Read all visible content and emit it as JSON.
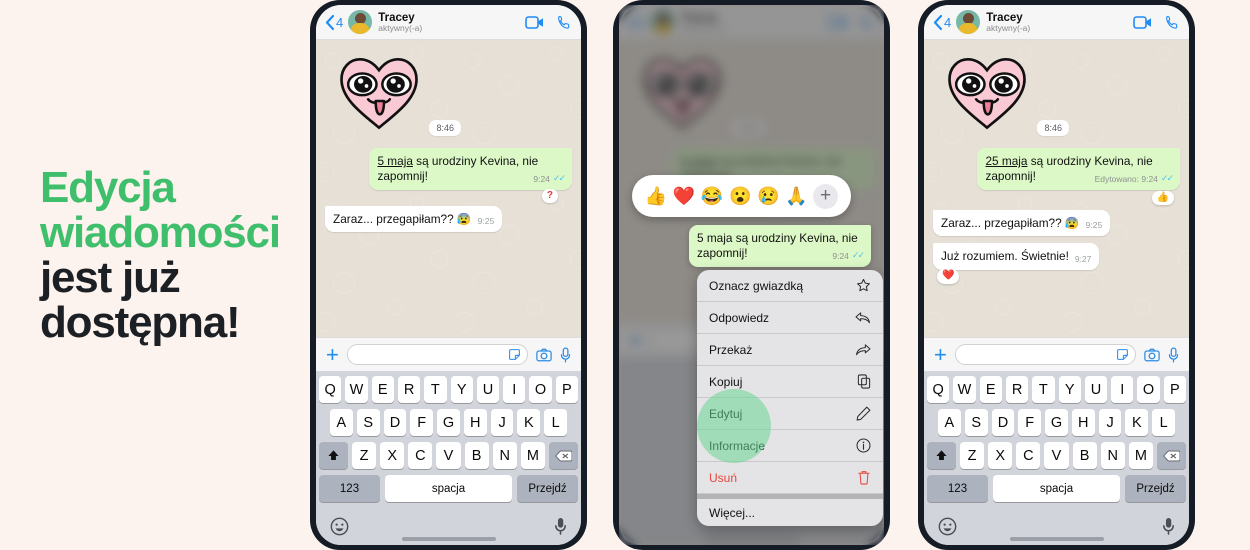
{
  "headline": {
    "line1": "Edycja",
    "line2": "wiadomości",
    "line3": "jest już",
    "line4": "dostępna!",
    "accent_color": "#3FBF6B",
    "dark_color": "#1C2024"
  },
  "background_color": "#FCF2EE",
  "header": {
    "back_count": "4",
    "contact_name": "Tracey",
    "status": "aktywny(-a)",
    "video_icon": "video-call-icon",
    "phone_icon": "voice-call-icon"
  },
  "phone1": {
    "sticker": "pink-heart-sticker",
    "day_time": "8:46",
    "messages": [
      {
        "side": "out",
        "text_underlined": "5 maja",
        "text_rest": " są urodziny Kevina, nie zapomnij!",
        "time": "9:24",
        "ticks": "✓✓",
        "reaction": "?"
      },
      {
        "side": "in",
        "text": "Zaraz... przegapiłam?? 😰",
        "time": "9:25"
      }
    ],
    "input_placeholder": ""
  },
  "phone2": {
    "emoji_reactions": [
      "👍",
      "❤️",
      "😂",
      "😮",
      "😢",
      "🙏"
    ],
    "add_reaction_label": "+",
    "focused_message": {
      "text_underlined": "5 maja",
      "text_rest": " są urodziny Kevina, nie zapomnij!",
      "time": "9:24",
      "ticks": "✓✓"
    },
    "context_menu": [
      {
        "label": "Oznacz gwiazdką",
        "icon": "star-icon"
      },
      {
        "label": "Odpowiedz",
        "icon": "reply-icon"
      },
      {
        "label": "Przekaż",
        "icon": "forward-icon"
      },
      {
        "label": "Kopiuj",
        "icon": "copy-icon"
      },
      {
        "label": "Edytuj",
        "icon": "pencil-icon",
        "highlighted": true
      },
      {
        "label": "Informacje",
        "icon": "info-icon"
      },
      {
        "label": "Usuń",
        "icon": "trash-icon",
        "danger": true
      },
      {
        "label": "Więcej...",
        "icon": "none",
        "separated": true
      }
    ]
  },
  "phone3": {
    "sticker": "pink-heart-sticker",
    "day_time": "8:46",
    "messages": [
      {
        "side": "out",
        "text_underlined": "25 maja",
        "text_rest": " są urodziny Kevina, nie zapomnij!",
        "edited_label": "Edytowano: 9:24",
        "ticks": "✓✓",
        "reaction": "👍"
      },
      {
        "side": "in",
        "text": "Zaraz... przegapiłam?? 😰",
        "time": "9:25"
      },
      {
        "side": "in",
        "text": "Już rozumiem. Świetnie!",
        "time": "9:27",
        "reaction": "❤️"
      }
    ],
    "input_placeholder": ""
  },
  "keyboard": {
    "row1": [
      "Q",
      "W",
      "E",
      "R",
      "T",
      "Y",
      "U",
      "I",
      "O",
      "P"
    ],
    "row2": [
      "A",
      "S",
      "D",
      "F",
      "G",
      "H",
      "J",
      "K",
      "L"
    ],
    "row3": [
      "Z",
      "X",
      "C",
      "V",
      "B",
      "N",
      "M"
    ],
    "shift_icon": "shift-icon",
    "backspace_icon": "backspace-icon",
    "numbers_key": "123",
    "space_key": "spacja",
    "go_key": "Przejdź"
  },
  "bottom_bar": {
    "emoji_icon": "emoji-smiley-icon",
    "mic_icon": "microphone-icon"
  },
  "input_bar": {
    "plus_icon": "plus-icon",
    "sticker_icon": "sticker-icon",
    "camera_icon": "camera-icon",
    "mic_icon": "microphone-icon"
  }
}
